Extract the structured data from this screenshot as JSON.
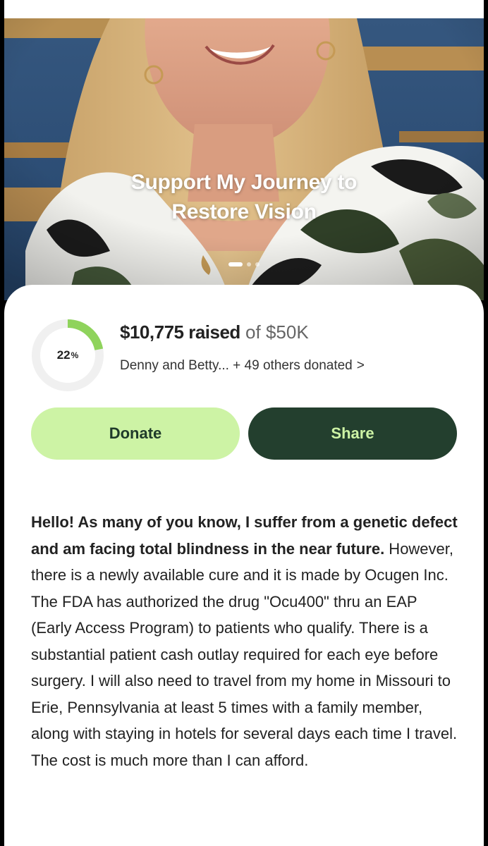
{
  "campaign": {
    "title_line1": "Support My Journey to",
    "title_line2": "Restore Vision",
    "carousel": {
      "slides": 3,
      "active": 1
    }
  },
  "progress": {
    "percent_value": 22,
    "percent_number": "22",
    "percent_sign": "%",
    "raised_amount": "$10,775 raised",
    "goal_text": "of $50K",
    "donors_text": "Denny and Betty... + 49 others donated",
    "donors_chevron": ">"
  },
  "actions": {
    "donate_label": "Donate",
    "share_label": "Share"
  },
  "story": {
    "bold_intro": "Hello! As many of you know, I suffer from a genetic defect and am facing total blindness in the near future.",
    "body": " However, there is a newly available cure and it is made by Ocugen Inc. The FDA has authorized the drug \"Ocu400\" thru an EAP (Early Access Program) to patients who qualify. There is a substantial patient cash outlay required for each eye before surgery. I will also need to travel from my home in Missouri to Erie, Pennsylvania at least 5 times with a family member, along with staying in hotels for several days each time I travel. The cost is much more than I can afford."
  },
  "colors": {
    "donate_bg": "#cdf3a5",
    "share_bg": "#233f2e",
    "progress_accent": "#8fd35c",
    "progress_track": "#f0f0f0"
  }
}
